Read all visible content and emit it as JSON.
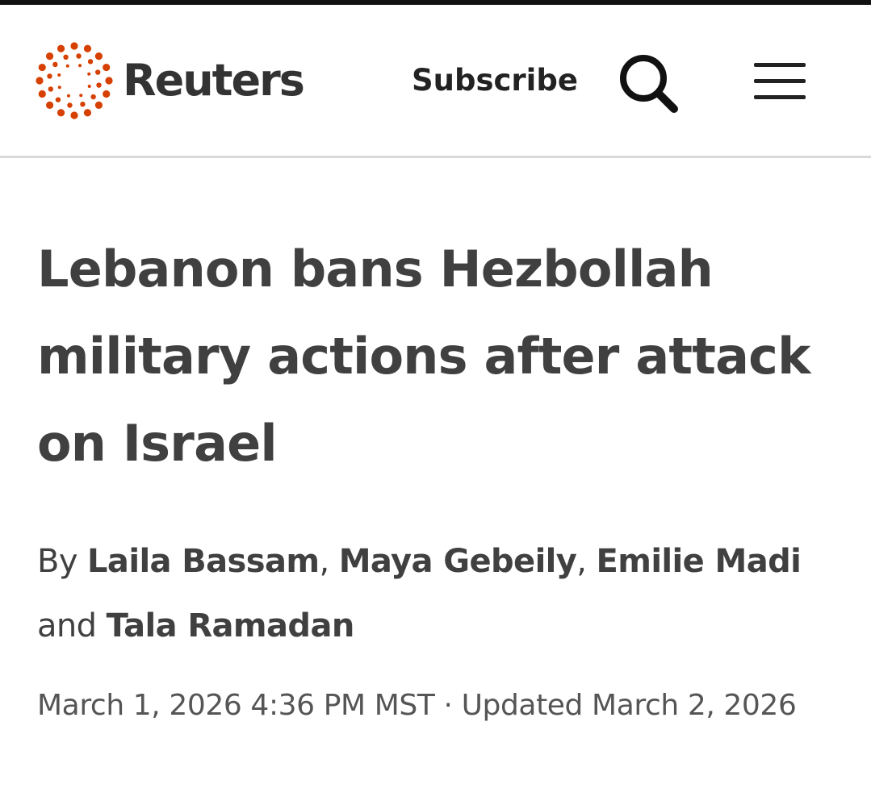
{
  "header": {
    "brand": "Reuters",
    "subscribe_label": "Subscribe",
    "search_icon": "search-icon",
    "menu_icon": "hamburger-menu-icon",
    "brand_color": "#d64000",
    "border_color": "#d9d9d9"
  },
  "article": {
    "headline": "Lebanon bans Hezbollah military actions after attack on Israel",
    "byline": {
      "prefix": "By",
      "authors": [
        "Laila Bassam",
        "Maya Gebeily",
        "Emilie Madi",
        "Tala Ramadan"
      ],
      "separator": ",",
      "conjunction": "and"
    },
    "published": "March 1, 2026 4:36 PM MST",
    "dot_separator": "·",
    "updated": "Updated March 2, 2026"
  }
}
